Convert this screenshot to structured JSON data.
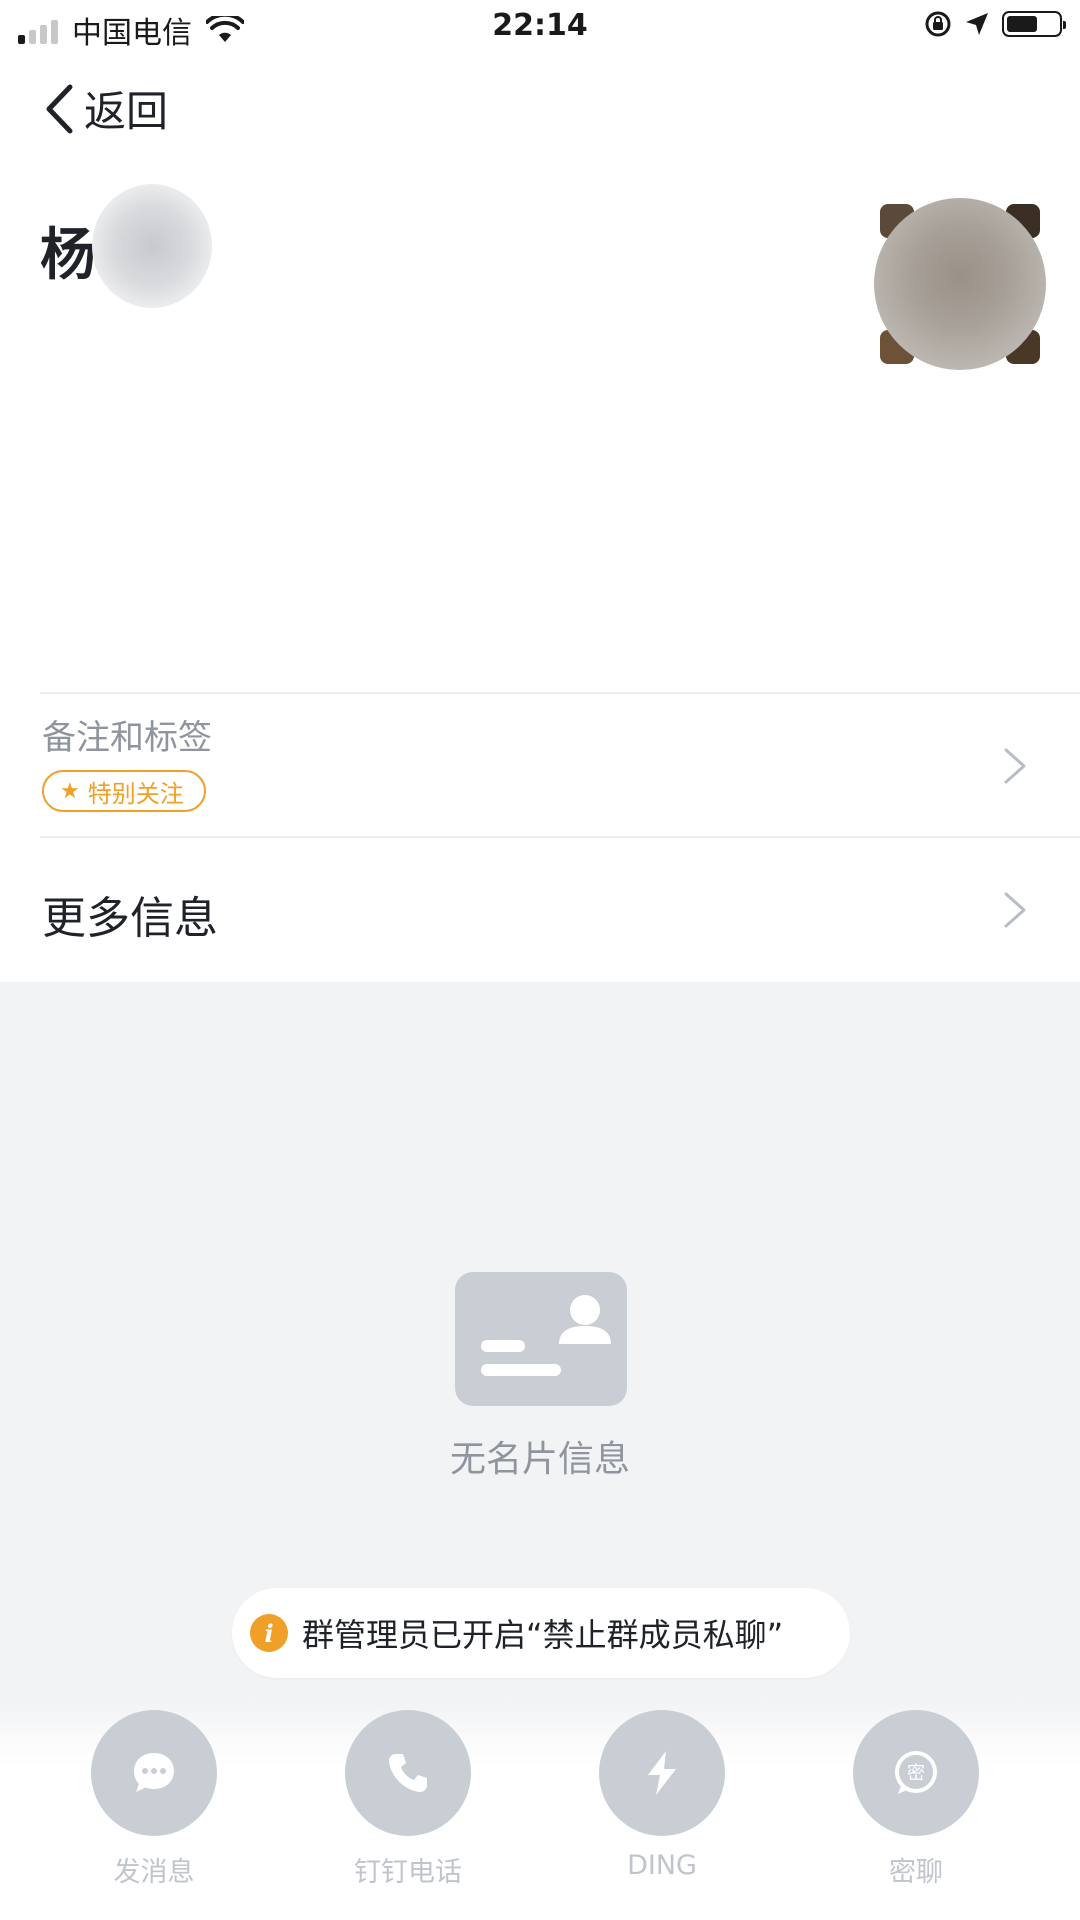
{
  "status_bar": {
    "carrier": "中国电信",
    "time": "22:14",
    "battery_level": 0.6
  },
  "nav": {
    "back_label": "返回"
  },
  "profile": {
    "name_visible": "杨"
  },
  "rows": {
    "remark_label": "备注和标签",
    "tag_label": "特别关注",
    "more_info_label": "更多信息"
  },
  "empty_state": {
    "label": "无名片信息",
    "icon": "business-card-icon"
  },
  "notice": {
    "icon": "info-icon",
    "text": "群管理员已开启“禁止群成员私聊”"
  },
  "actions": [
    {
      "label": "发消息",
      "icon": "chat-bubble-icon"
    },
    {
      "label": "钉钉电话",
      "icon": "phone-icon"
    },
    {
      "label": "DING",
      "icon": "lightning-icon"
    },
    {
      "label": "密聊",
      "icon": "secret-chat-icon"
    }
  ],
  "colors": {
    "accent_orange": "#f0a028",
    "disabled_grey": "#c9cdd4",
    "background_grey": "#f2f3f5",
    "text_primary": "#1f2329",
    "text_secondary": "#8f959e"
  }
}
